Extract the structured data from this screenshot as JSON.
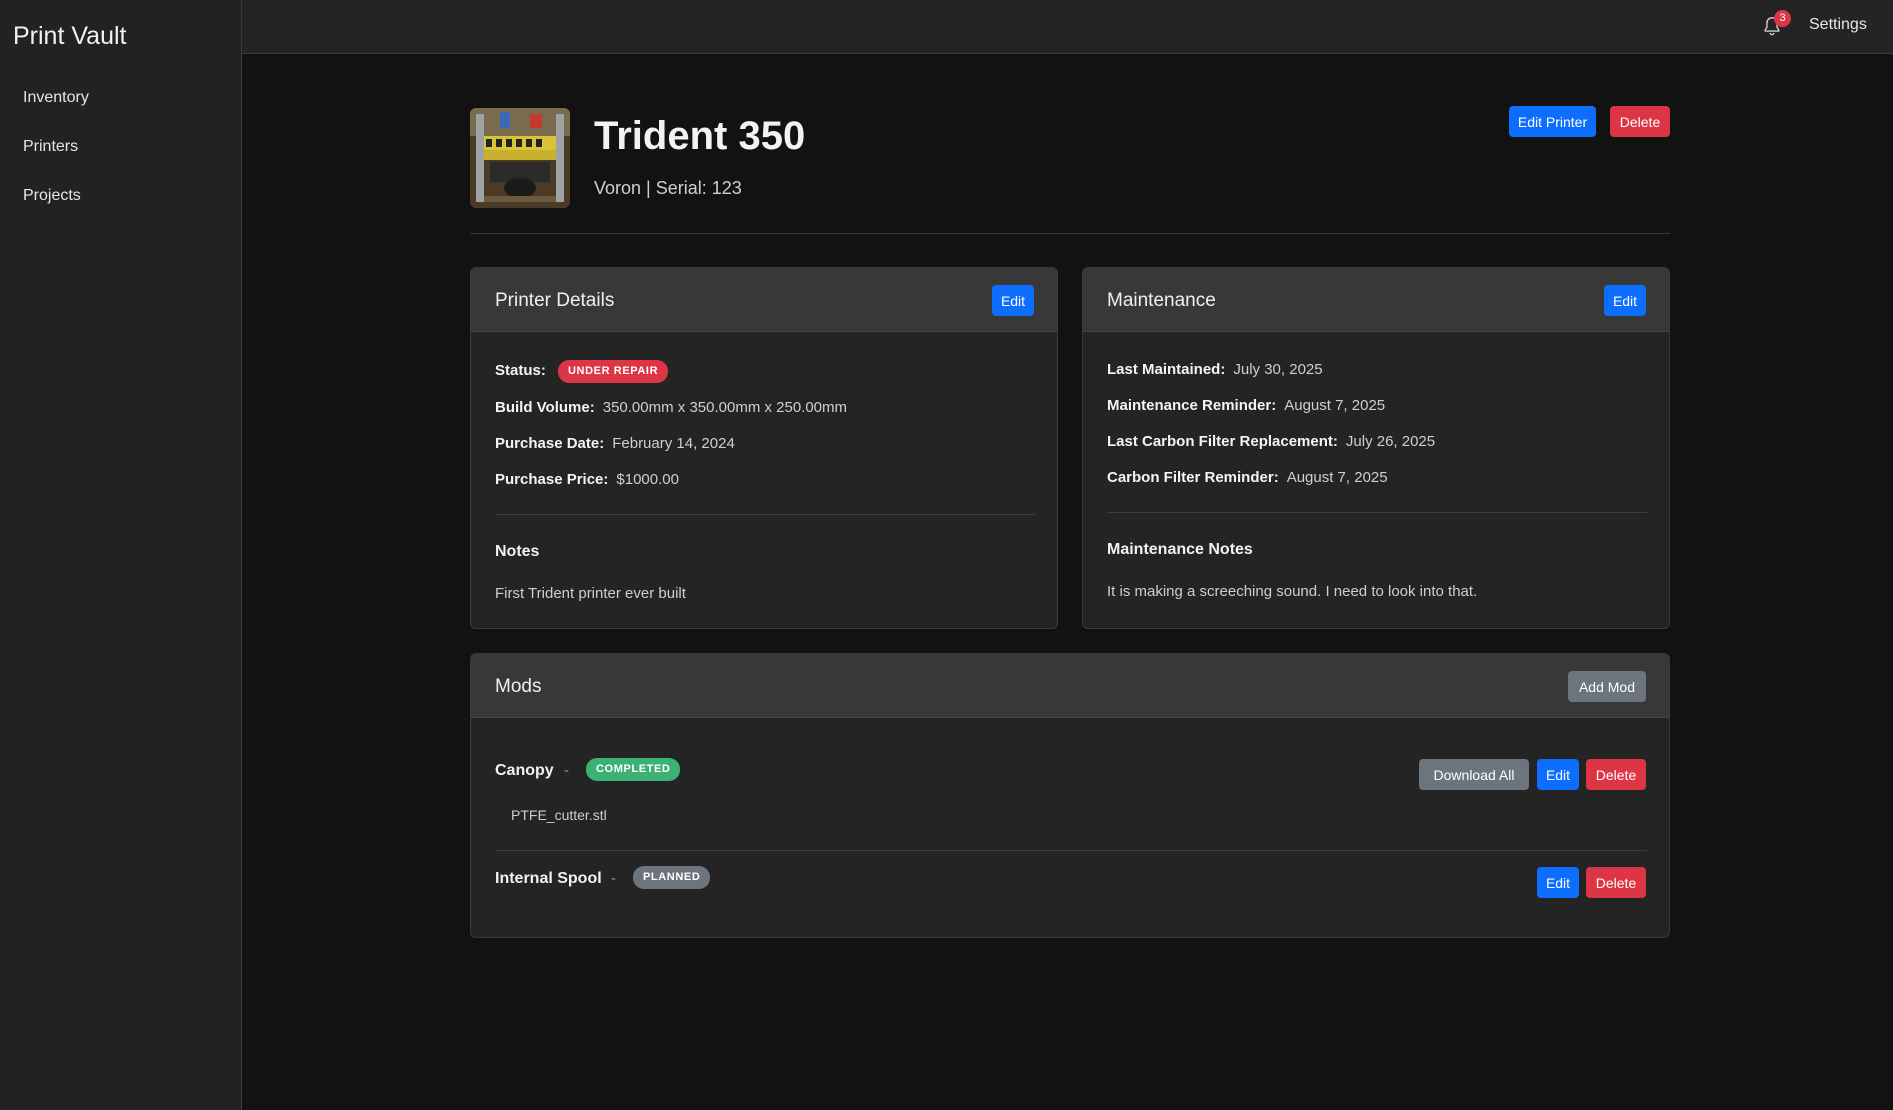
{
  "app": {
    "title": "Print Vault"
  },
  "sidebar": {
    "items": [
      {
        "label": "Inventory"
      },
      {
        "label": "Printers"
      },
      {
        "label": "Projects"
      }
    ]
  },
  "topbar": {
    "notification_count": "3",
    "settings_label": "Settings"
  },
  "printer": {
    "name": "Trident 350",
    "subtitle": "Voron | Serial: 123",
    "edit_label": "Edit Printer",
    "delete_label": "Delete"
  },
  "details": {
    "title": "Printer Details",
    "edit_label": "Edit",
    "status_label": "Status:",
    "status_value": "UNDER REPAIR",
    "build_volume_label": "Build Volume:",
    "build_volume_value": "350.00mm x 350.00mm x 250.00mm",
    "purchase_date_label": "Purchase Date:",
    "purchase_date_value": "February 14, 2024",
    "purchase_price_label": "Purchase Price:",
    "purchase_price_value": "$1000.00",
    "notes_heading": "Notes",
    "notes_text": "First Trident printer ever built"
  },
  "maintenance": {
    "title": "Maintenance",
    "edit_label": "Edit",
    "last_maintained_label": "Last Maintained:",
    "last_maintained_value": "July 30, 2025",
    "reminder_label": "Maintenance Reminder:",
    "reminder_value": "August 7, 2025",
    "carbon_replacement_label": "Last Carbon Filter Replacement:",
    "carbon_replacement_value": "July 26, 2025",
    "carbon_reminder_label": "Carbon Filter Reminder:",
    "carbon_reminder_value": "August 7, 2025",
    "notes_heading": "Maintenance Notes",
    "notes_text": "It is making a screeching sound. I need to look into that."
  },
  "mods": {
    "title": "Mods",
    "add_label": "Add Mod",
    "separator": "-",
    "items": [
      {
        "name": "Canopy",
        "status": "COMPLETED",
        "file": "PTFE_cutter.stl",
        "download_label": "Download All",
        "edit_label": "Edit",
        "delete_label": "Delete"
      },
      {
        "name": "Internal Spool",
        "status": "PLANNED",
        "edit_label": "Edit",
        "delete_label": "Delete"
      }
    ]
  },
  "colors": {
    "background": "#121212",
    "sidebar": "#222222",
    "card": "#242424",
    "card_header": "#383838",
    "primary": "#0d6efd",
    "danger": "#dc3545",
    "success": "#3bb273",
    "secondary": "#6c757d"
  }
}
